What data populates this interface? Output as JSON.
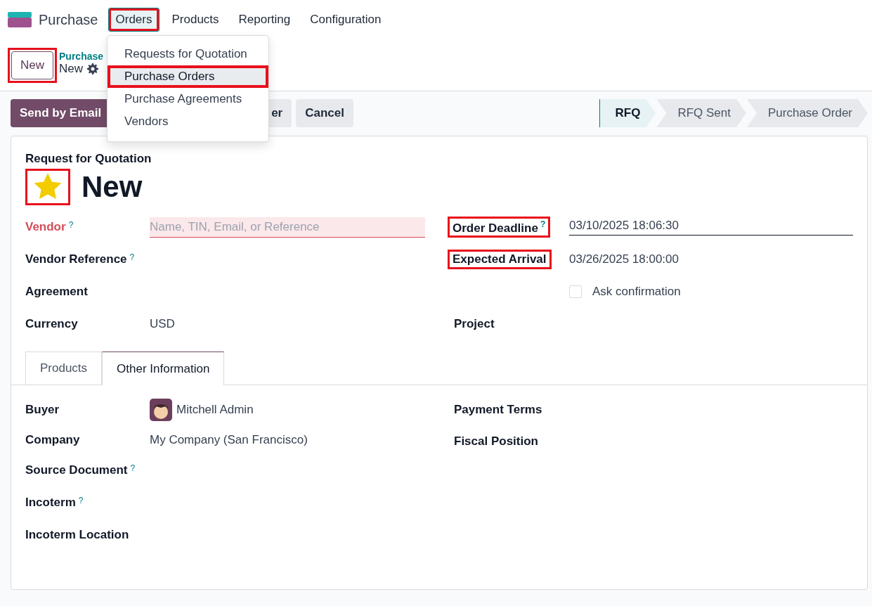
{
  "app": {
    "name": "Purchase"
  },
  "menu": [
    {
      "label": "Orders",
      "selected": true,
      "highlighted": true
    },
    {
      "label": "Products",
      "selected": false,
      "highlighted": false
    },
    {
      "label": "Reporting",
      "selected": false,
      "highlighted": false
    },
    {
      "label": "Configuration",
      "selected": false,
      "highlighted": false
    }
  ],
  "dropdown": [
    {
      "label": "Requests for Quotation",
      "selected": false,
      "highlighted": false
    },
    {
      "label": "Purchase Orders",
      "selected": true,
      "highlighted": true
    },
    {
      "label": "Purchase Agreements",
      "selected": false,
      "highlighted": false
    },
    {
      "label": "Vendors",
      "selected": false,
      "highlighted": false
    }
  ],
  "new_button": {
    "label": "New",
    "highlighted": true
  },
  "breadcrumb": {
    "parent": "Purchase",
    "current": "New"
  },
  "actions": [
    {
      "label": "Send by Email",
      "kind": "primary"
    },
    {
      "label": "er",
      "kind": "secondary"
    },
    {
      "label": "Cancel",
      "kind": "secondary"
    }
  ],
  "stages": [
    {
      "label": "RFQ",
      "selected": true
    },
    {
      "label": "RFQ Sent",
      "selected": false
    },
    {
      "label": "Purchase Order",
      "selected": false
    }
  ],
  "form": {
    "subtitle": "Request for Quotation",
    "priority": {
      "starred": true,
      "highlighted": true
    },
    "title": "New",
    "left_fields": [
      {
        "label": "Vendor",
        "help": "?",
        "required": true,
        "kind": "input",
        "placeholder": "Name, TIN, Email, or Reference"
      },
      {
        "label": "Vendor Reference",
        "help": "?",
        "required": false,
        "kind": "text"
      },
      {
        "label": "Agreement",
        "required": false,
        "kind": "text"
      },
      {
        "label": "Currency",
        "required": false,
        "kind": "text",
        "value": "USD"
      }
    ],
    "right_fields": [
      {
        "label": "Order Deadline",
        "help": "?",
        "kind": "date",
        "value": "03/10/2025 18:06:30",
        "highlighted": true
      },
      {
        "label": "Expected Arrival",
        "kind": "text",
        "value": "03/26/2025 18:00:00",
        "highlighted": true
      },
      {
        "kind": "checkbox",
        "value": "Ask confirmation",
        "checked": false,
        "highlighted": false
      },
      {
        "label": "Project",
        "kind": "text",
        "highlighted": false
      }
    ]
  },
  "tabs": [
    {
      "label": "Products",
      "selected": false
    },
    {
      "label": "Other Information",
      "selected": true
    }
  ],
  "other_info": {
    "left_fields": [
      {
        "label": "Buyer",
        "kind": "user",
        "value": "Mitchell Admin"
      },
      {
        "label": "Company",
        "kind": "text",
        "value": "My Company (San Francisco)"
      },
      {
        "label": "Source Document",
        "help": "?",
        "kind": "text"
      },
      {
        "label": "Incoterm",
        "help": "?",
        "kind": "text"
      },
      {
        "label": "Incoterm Location",
        "kind": "text"
      }
    ],
    "right_fields": [
      {
        "label": "Payment Terms"
      },
      {
        "label": "Fiscal Position"
      }
    ]
  }
}
